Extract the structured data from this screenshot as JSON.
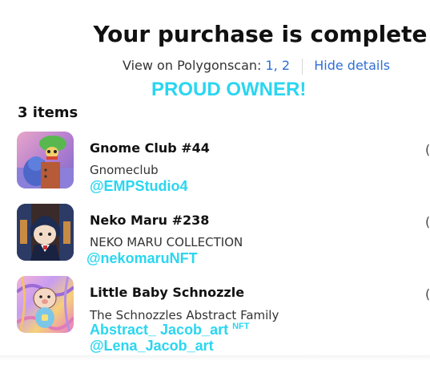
{
  "header": {
    "title": "Your purchase is complete",
    "view_on": "View on Polygonscan:",
    "link_1": "1,",
    "link_2": "2",
    "hide_details": "Hide details"
  },
  "overlay": {
    "proud": "PROUD OWNER!",
    "color": "#2ad6f0"
  },
  "items_count": "3 items",
  "items": [
    {
      "name": "Gnome Club #44",
      "collection": "Gnomeclub",
      "handle": "@EMPStudio4",
      "icon": "gnome-nft-thumbnail"
    },
    {
      "name": "Neko Maru #238",
      "collection": "NEKO MARU COLLECTION",
      "handle": "@nekomaruNFT",
      "icon": "neko-nft-thumbnail"
    },
    {
      "name": "Little Baby Schnozzle",
      "collection": "The Schnozzles Abstract Family",
      "handle_line1": "Abstract_ Jacob_art",
      "handle_sup": "NFT",
      "handle_line2": "@Lena_Jacob_art",
      "icon": "schnozzle-nft-thumbnail"
    }
  ],
  "edge_mark": "("
}
